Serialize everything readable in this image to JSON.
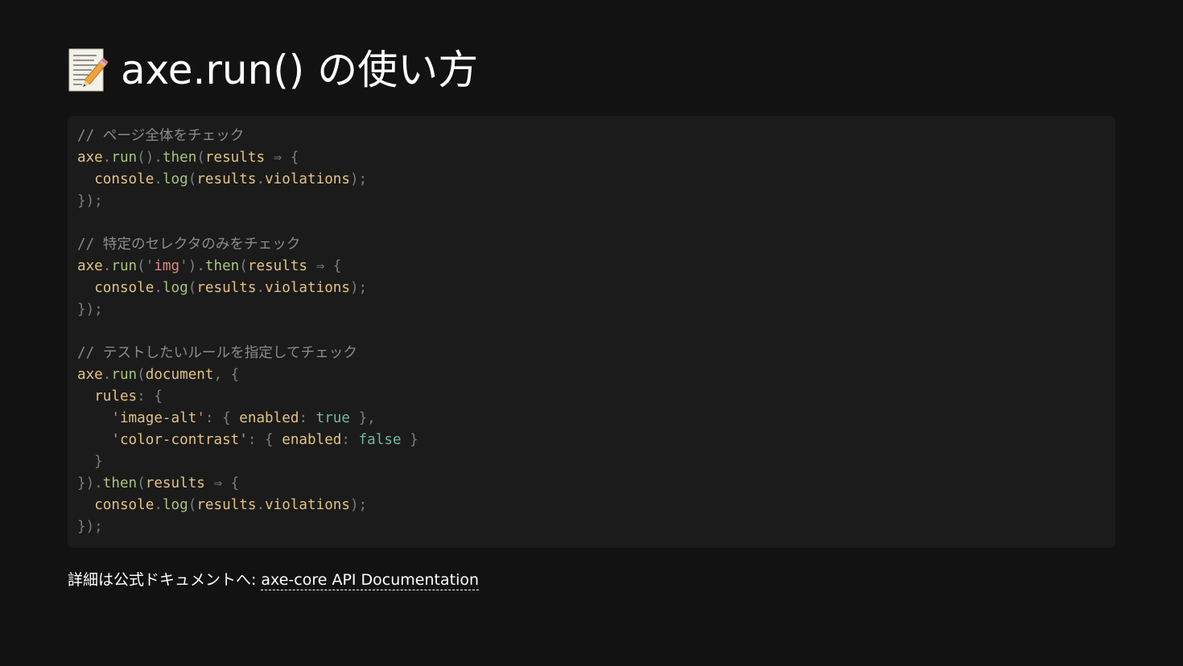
{
  "title": {
    "icon": "memo-icon",
    "text": "axe.run() の使い方"
  },
  "code": {
    "block1": {
      "comment": "// ページ全体をチェック",
      "l1": {
        "obj": "axe",
        "dot1": ".",
        "run": "run",
        "p1": "().",
        "then": "then",
        "p2": "(",
        "param": "results",
        "arrow": " ⇒ {"
      },
      "l2": {
        "indent": "  ",
        "obj": "console",
        "dot1": ".",
        "fn": "log",
        "p1": "(",
        "arg": "results",
        "dot2": ".",
        "prop": "violations",
        "p2": ");"
      },
      "l3": "});"
    },
    "block2": {
      "comment": "// 特定のセレクタのみをチェック",
      "l1": {
        "obj": "axe",
        "dot1": ".",
        "run": "run",
        "p1": "(",
        "q1": "'",
        "str": "img",
        "q2": "'",
        "p2": ").",
        "then": "then",
        "p3": "(",
        "param": "results",
        "arrow": " ⇒ {"
      },
      "l2": {
        "indent": "  ",
        "obj": "console",
        "dot1": ".",
        "fn": "log",
        "p1": "(",
        "arg": "results",
        "dot2": ".",
        "prop": "violations",
        "p2": ");"
      },
      "l3": "});"
    },
    "block3": {
      "comment": "// テストしたいルールを指定してチェック",
      "l1": {
        "obj": "axe",
        "dot1": ".",
        "run": "run",
        "p1": "(",
        "arg": "document",
        "p2": ", {"
      },
      "l2": {
        "indent": "  ",
        "key": "rules",
        "p1": ": {"
      },
      "l3": {
        "indent": "    ",
        "q1": "'",
        "str": "image-alt",
        "q2": "'",
        "p1": ": { ",
        "key": "enabled",
        "p2": ": ",
        "val": "true",
        "p3": " },"
      },
      "l4": {
        "indent": "    ",
        "q1": "'",
        "str": "color-contrast",
        "q2": "'",
        "p1": ": { ",
        "key": "enabled",
        "p2": ": ",
        "val": "false",
        "p3": " }"
      },
      "l5": "  }",
      "l6": {
        "p1": "}).",
        "then": "then",
        "p2": "(",
        "param": "results",
        "arrow": " ⇒ {"
      },
      "l7": {
        "indent": "  ",
        "obj": "console",
        "dot1": ".",
        "fn": "log",
        "p1": "(",
        "arg": "results",
        "dot2": ".",
        "prop": "violations",
        "p2": ");"
      },
      "l8": "});"
    }
  },
  "footer": {
    "label": "詳細は公式ドキュメントへ:",
    "link_text": "axe-core API Documentation"
  },
  "colors": {
    "background": "#121212",
    "code_background": "#1b1b1b",
    "comment": "#8b8b8b",
    "identifier": "#e3c282",
    "function": "#a6c57b",
    "string": "#d98a7a",
    "literal": "#6fb7a0"
  }
}
